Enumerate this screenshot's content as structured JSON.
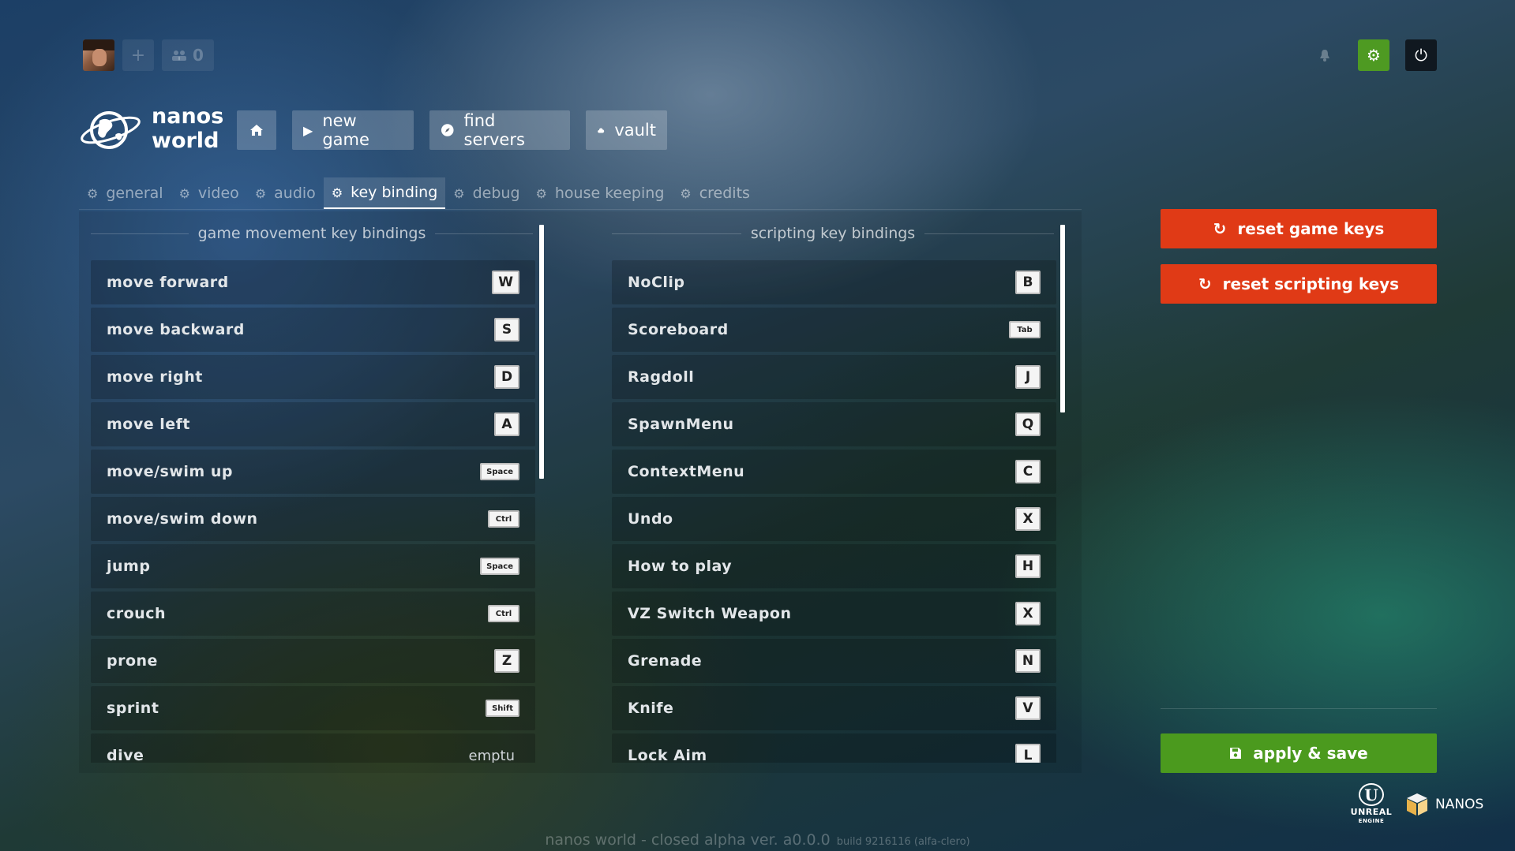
{
  "topbar": {
    "friends_count": "0",
    "plus_icon": "plus-icon",
    "friends_icon": "friends-icon",
    "bell_icon": "bell-icon",
    "settings_icon": "gear-icon",
    "power_icon": "power-icon"
  },
  "logo": {
    "line1": "nanos",
    "line2": "world"
  },
  "nav": {
    "home_icon": "home-icon",
    "new_game": "new game",
    "find_servers": "find servers",
    "vault": "vault"
  },
  "tabs": [
    "general",
    "video",
    "audio",
    "key binding",
    "debug",
    "house keeping",
    "credits"
  ],
  "active_tab": "key binding",
  "game_keys": {
    "title": "game movement key bindings",
    "rows": [
      {
        "label": "move forward",
        "key": "W"
      },
      {
        "label": "move backward",
        "key": "S"
      },
      {
        "label": "move right",
        "key": "D"
      },
      {
        "label": "move left",
        "key": "A"
      },
      {
        "label": "move/swim up",
        "key": "Space"
      },
      {
        "label": "move/swim down",
        "key": "Ctrl"
      },
      {
        "label": "jump",
        "key": "Space"
      },
      {
        "label": "crouch",
        "key": "Ctrl"
      },
      {
        "label": "prone",
        "key": "Z"
      },
      {
        "label": "sprint",
        "key": "Shift"
      },
      {
        "label": "dive",
        "key": "emptu"
      }
    ]
  },
  "scripting_keys": {
    "title": "scripting key bindings",
    "rows": [
      {
        "label": "NoClip",
        "key": "B"
      },
      {
        "label": "Scoreboard",
        "key": "Tab"
      },
      {
        "label": "Ragdoll",
        "key": "J"
      },
      {
        "label": "SpawnMenu",
        "key": "Q"
      },
      {
        "label": "ContextMenu",
        "key": "C"
      },
      {
        "label": "Undo",
        "key": "X"
      },
      {
        "label": "How to play",
        "key": "H"
      },
      {
        "label": "VZ Switch Weapon",
        "key": "X"
      },
      {
        "label": "Grenade",
        "key": "N"
      },
      {
        "label": "Knife",
        "key": "V"
      },
      {
        "label": "Lock Aim",
        "key": "L"
      }
    ]
  },
  "actions": {
    "reset_game_keys": "reset game keys",
    "reset_scripting_keys": "reset scripting keys",
    "apply_save": "apply & save",
    "reset_icon": "reset-icon",
    "save_icon": "floppy-icon"
  },
  "brands": {
    "unreal_line1": "UNREAL",
    "unreal_line2": "ENGINE",
    "nanos": "NANOS"
  },
  "footer": {
    "version": "nanos world - closed alpha  ver. a0.0.0",
    "build": "build 9216116  (alfa-clero)"
  },
  "colors": {
    "red": "#e03a16",
    "green": "#4b9a1e",
    "gear_green": "#4e9a22"
  }
}
